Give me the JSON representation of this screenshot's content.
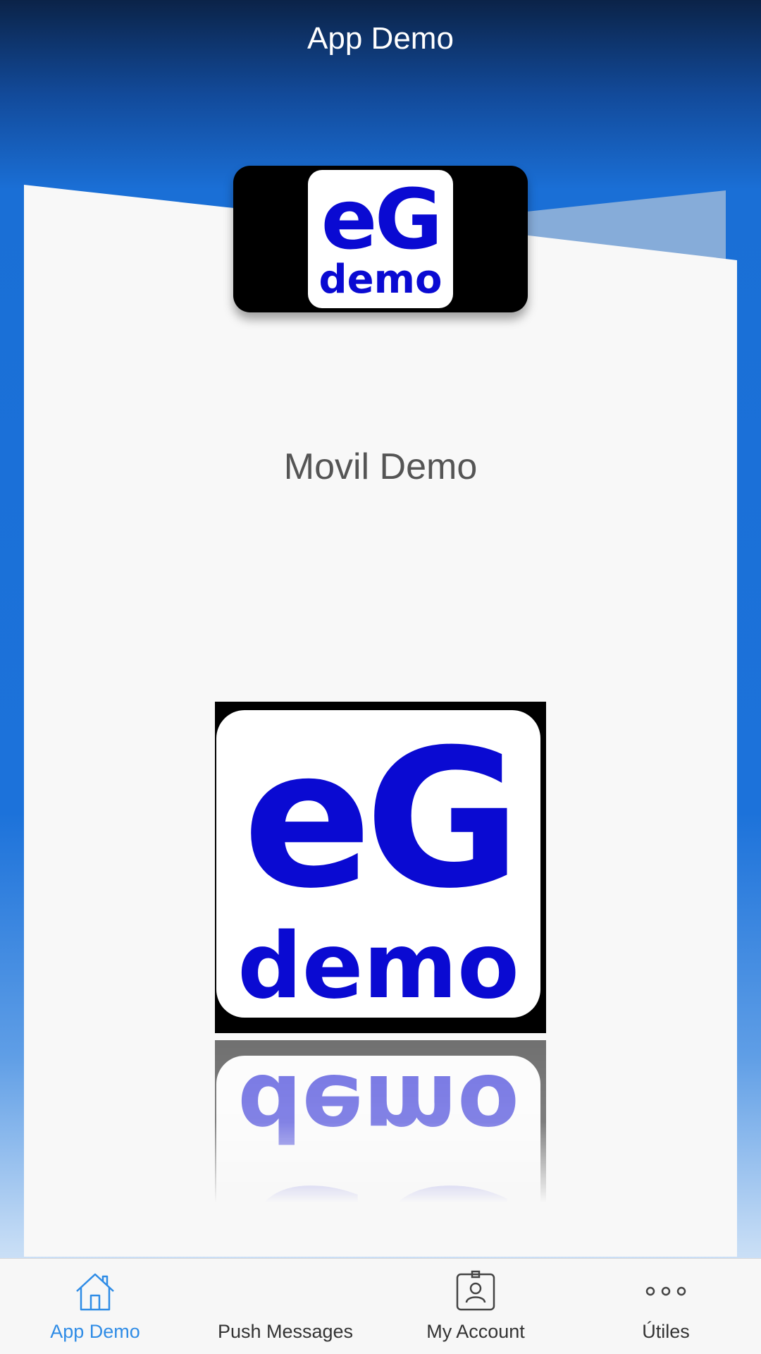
{
  "nav": {
    "title": "App Demo"
  },
  "main": {
    "headline": "Movil Demo",
    "logo": {
      "line1": "eG",
      "line2": "demo"
    }
  },
  "tabbar": {
    "active_color": "#2f8ce6",
    "tabs": [
      {
        "label": "App Demo",
        "icon": "home-icon",
        "active": true
      },
      {
        "label": "Push Messages",
        "icon": "none",
        "active": false
      },
      {
        "label": "My Account",
        "icon": "id-badge-icon",
        "active": false
      },
      {
        "label": "Útiles",
        "icon": "more-dots-icon",
        "active": false
      }
    ]
  }
}
